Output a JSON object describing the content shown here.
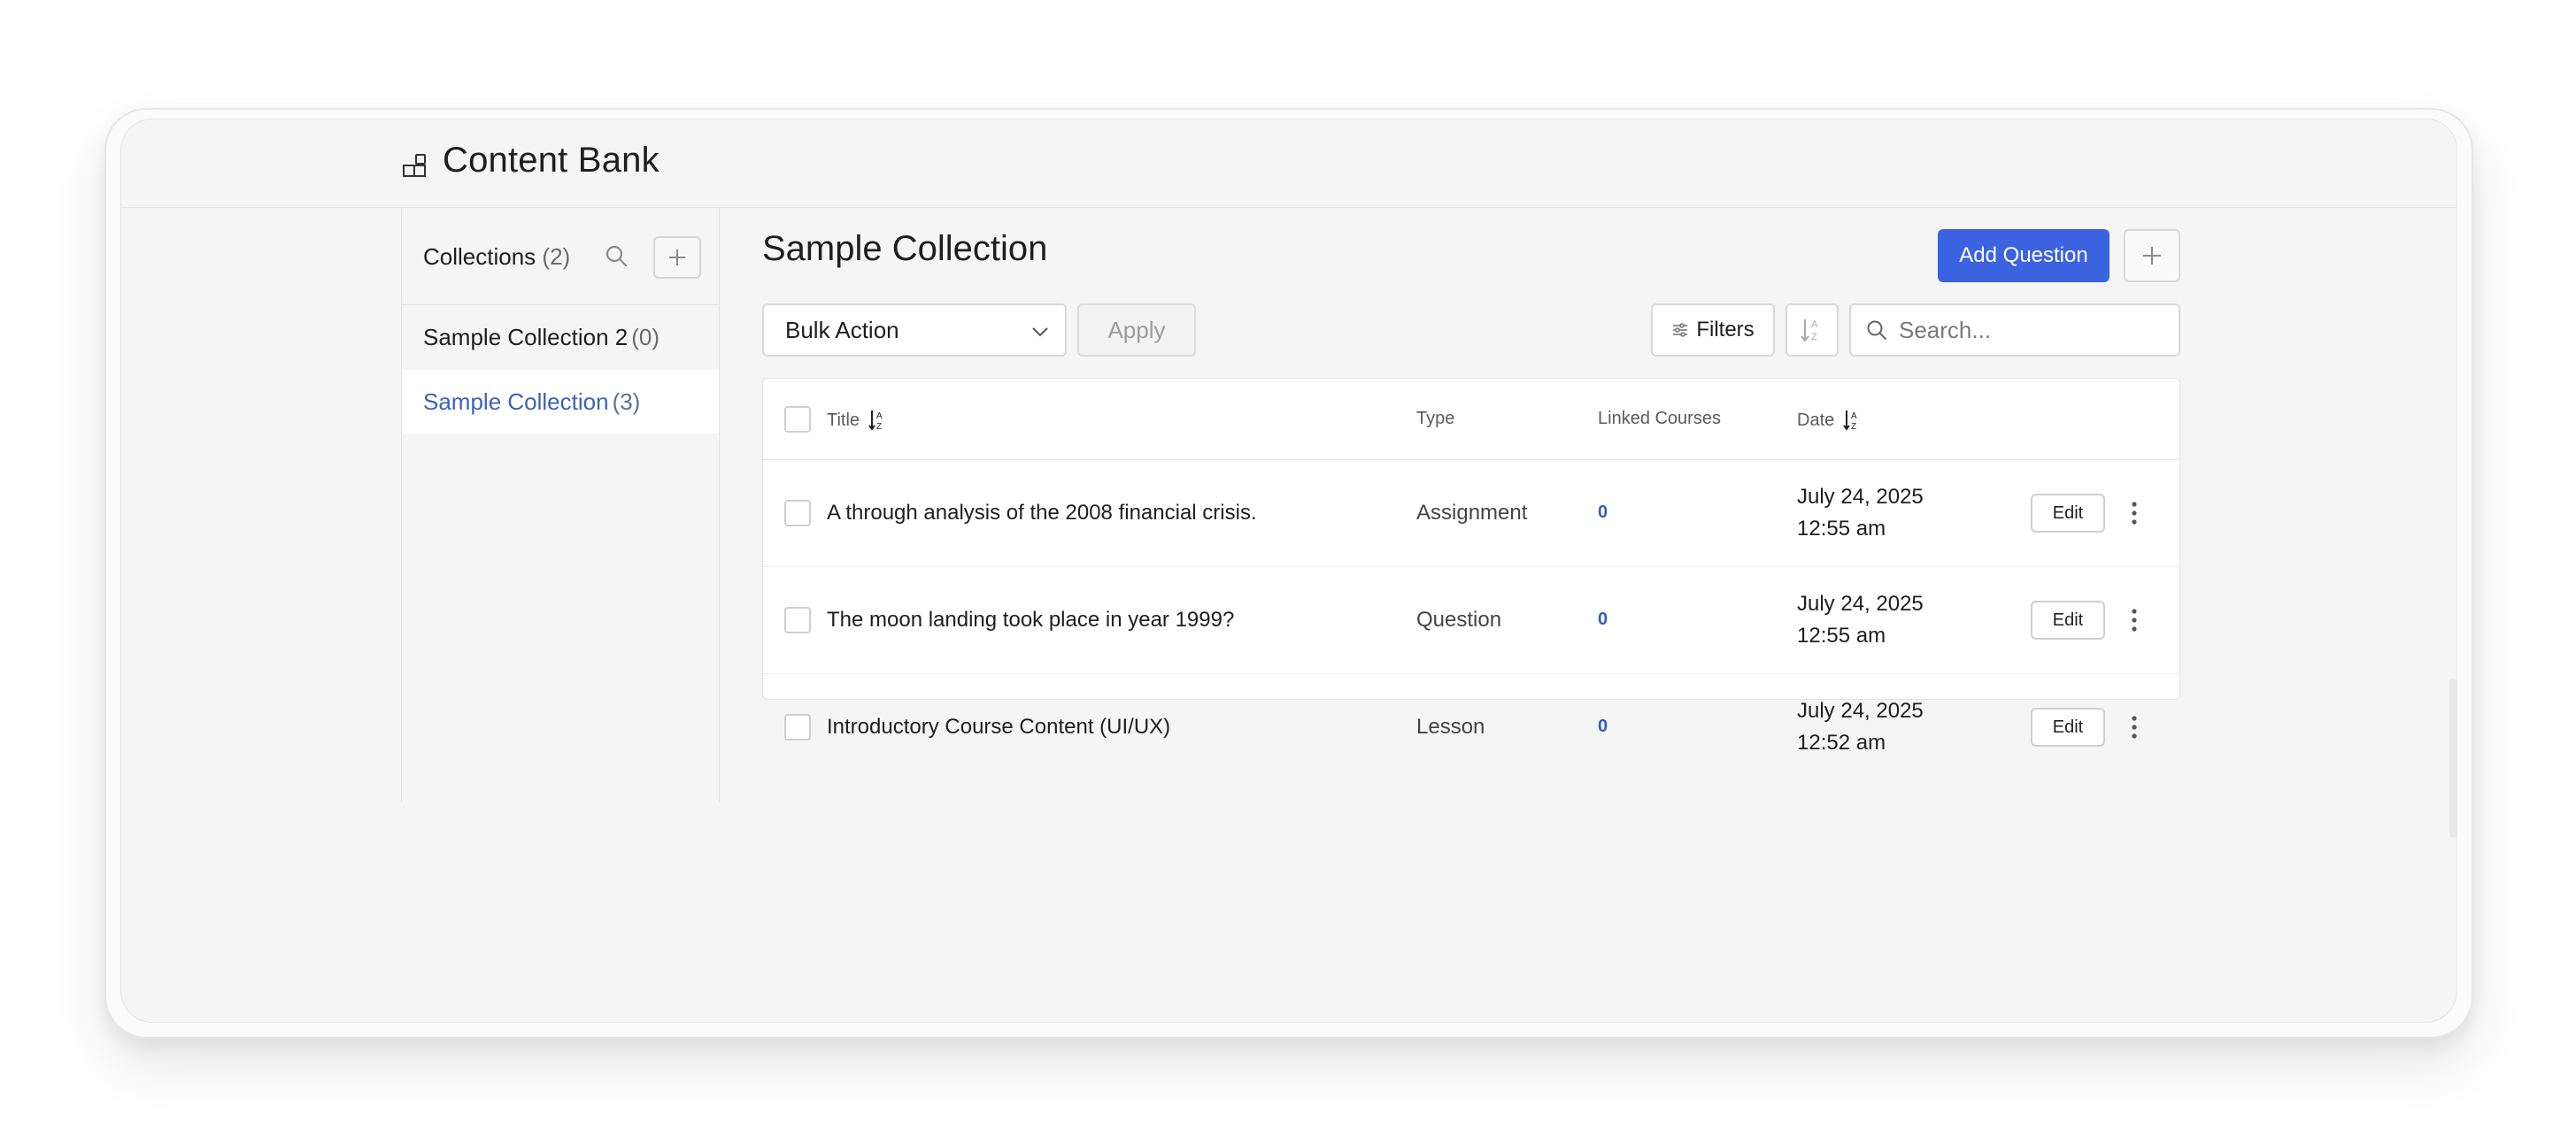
{
  "header": {
    "title": "Content Bank",
    "icon": "content-bank-icon"
  },
  "sidebar": {
    "title": "Collections",
    "count": "(2)",
    "items": [
      {
        "label": "Sample Collection 2",
        "count": "(0)",
        "active": false
      },
      {
        "label": "Sample Collection",
        "count": "(3)",
        "active": true
      }
    ]
  },
  "main": {
    "title": "Sample Collection",
    "add_question_label": "Add Question",
    "bulk_action": {
      "selected": "Bulk Action"
    },
    "apply_label": "Apply",
    "filters_label": "Filters",
    "search": {
      "placeholder": "Search..."
    }
  },
  "table": {
    "columns": {
      "title": "Title",
      "type": "Type",
      "linked": "Linked Courses",
      "date": "Date"
    },
    "rows": [
      {
        "title": "A through analysis of the 2008 financial crisis.",
        "type": "Assignment",
        "linked": "0",
        "date": "July 24, 2025",
        "time": "12:55 am",
        "edit": "Edit"
      },
      {
        "title": "The moon landing took place in year 1999?",
        "type": "Question",
        "linked": "0",
        "date": "July 24, 2025",
        "time": "12:55 am",
        "edit": "Edit"
      },
      {
        "title": "Introductory Course Content (UI/UX)",
        "type": "Lesson",
        "linked": "0",
        "date": "July 24, 2025",
        "time": "12:52 am",
        "edit": "Edit"
      }
    ]
  },
  "colors": {
    "accent": "#3b63e0",
    "active_link": "#3a63b8",
    "linked_count": "#2f5fc0"
  }
}
